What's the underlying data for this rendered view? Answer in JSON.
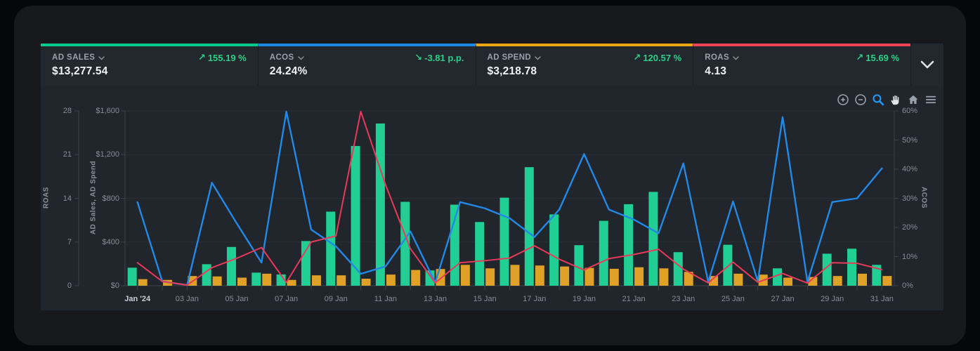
{
  "kpis": [
    {
      "label": "AD SALES",
      "value": "$13,277.54",
      "arrow": "↗",
      "delta": "155.19 %",
      "accent": "#00c98c"
    },
    {
      "label": "ACOS",
      "value": "24.24%",
      "arrow": "↘",
      "delta": "-3.81 p.p.",
      "accent": "#1d87e4"
    },
    {
      "label": "AD SPEND",
      "value": "$3,218.78",
      "arrow": "↗",
      "delta": "120.57 %",
      "accent": "#eda512"
    },
    {
      "label": "ROAS",
      "value": "4.13",
      "arrow": "↗",
      "delta": "15.69 %",
      "accent": "#ef4458"
    }
  ],
  "toolbar": {
    "icons": [
      "zoom-in",
      "zoom-out",
      "selection-zoom",
      "pan",
      "home",
      "menu"
    ],
    "active_color": "#2196f3",
    "pan_color": "#e2e6eb",
    "idle_color": "#97a0ab"
  },
  "chart_data": {
    "type": "mixed",
    "x_tick_labels": [
      "Jan '24",
      "03 Jan",
      "05 Jan",
      "07 Jan",
      "09 Jan",
      "11 Jan",
      "13 Jan",
      "15 Jan",
      "17 Jan",
      "19 Jan",
      "21 Jan",
      "23 Jan",
      "25 Jan",
      "27 Jan",
      "29 Jan",
      "31 Jan"
    ],
    "days": 31,
    "series": [
      {
        "name": "AD Sales",
        "type": "bar",
        "axis": "money",
        "color": "#21ce94",
        "values": [
          165,
          0,
          0,
          197,
          355,
          120,
          103,
          409,
          678,
          1279,
          1485,
          768,
          140,
          742,
          583,
          806,
          1085,
          653,
          371,
          594,
          746,
          859,
          307,
          0,
          375,
          0,
          159,
          0,
          293,
          339,
          191
        ]
      },
      {
        "name": "AD Spend",
        "type": "bar",
        "axis": "money",
        "color": "#dfa128",
        "values": [
          60,
          53,
          89,
          85,
          74,
          110,
          53,
          95,
          95,
          64,
          102,
          144,
          153,
          191,
          159,
          191,
          185,
          176,
          163,
          155,
          169,
          159,
          127,
          89,
          110,
          102,
          74,
          80,
          89,
          110,
          89
        ]
      },
      {
        "name": "ROAS",
        "type": "line",
        "axis": "roas",
        "color": "#2289e6",
        "values": [
          13.4,
          0.7,
          0.1,
          16.5,
          10,
          3.7,
          27.9,
          9,
          6.3,
          1.9,
          3.1,
          8.7,
          0.5,
          13.4,
          12.4,
          10.8,
          7.8,
          12.2,
          21.1,
          12.2,
          10.6,
          8.4,
          19.6,
          0.6,
          13.5,
          0.7,
          27,
          0.6,
          13.4,
          14,
          18.8
        ]
      },
      {
        "name": "ACOS",
        "type": "line",
        "axis": "acos",
        "color": "#e83a59",
        "values": [
          7.9,
          1.5,
          0.2,
          6.2,
          9.4,
          13.1,
          1.1,
          15,
          17.1,
          59.8,
          34.6,
          12.7,
          1,
          7.9,
          8.6,
          9.5,
          13.7,
          9.1,
          5.4,
          9.3,
          10.7,
          12.5,
          5.7,
          1,
          8.1,
          1.2,
          4.2,
          0.9,
          7.9,
          7.7,
          5.5
        ]
      }
    ],
    "axes": {
      "roas": {
        "title": "ROAS",
        "ticks": [
          "0",
          "7",
          "14",
          "21",
          "28"
        ],
        "max": 28,
        "position": "left-outer"
      },
      "money": {
        "title": "AD Sales, AD Spend",
        "ticks": [
          "$0",
          "$400",
          "$800",
          "$1,200",
          "$1,600"
        ],
        "max": 1600,
        "position": "left-inner"
      },
      "acos": {
        "title": "ACOS",
        "ticks": [
          "0%",
          "10%",
          "20%",
          "30%",
          "40%",
          "50%",
          "60%"
        ],
        "max": 60,
        "position": "right"
      }
    },
    "grid": true,
    "legend": "none"
  },
  "theme": {
    "page_bg": "#06070a",
    "card_bg": "#17191d",
    "strip_bg": "#23272e",
    "chart_bg": "#21252c",
    "grid_color": "#2a2e36",
    "axis_color": "#3c424c",
    "tick_text": "#878e99",
    "delta_green": "#2bd086"
  }
}
